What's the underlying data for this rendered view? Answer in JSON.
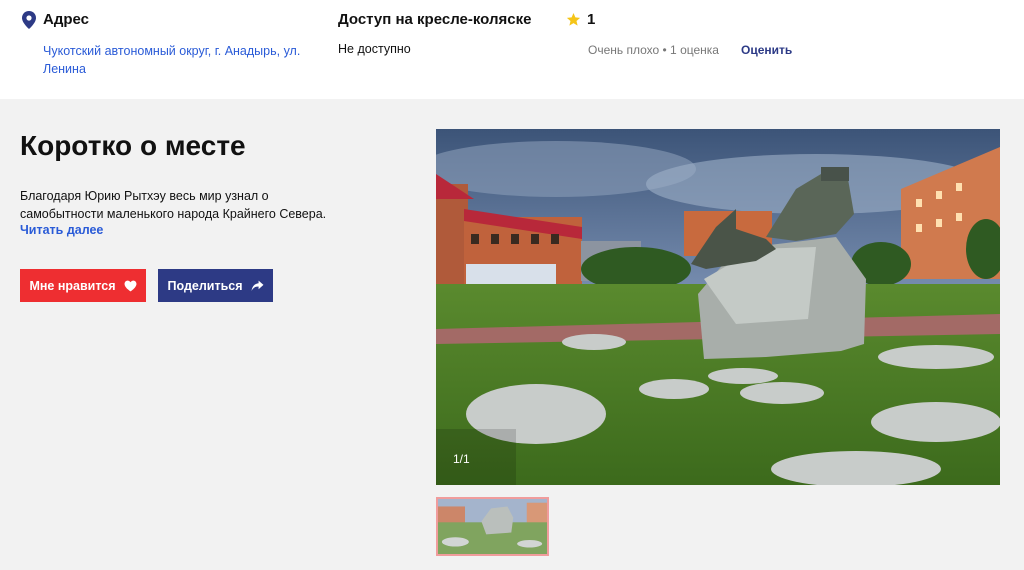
{
  "info": {
    "address": {
      "icon": "location-pin-icon",
      "title": "Адрес",
      "value": "Чукотский автономный округ, г. Анадырь, ул. Ленина"
    },
    "accessibility": {
      "title": "Доступ на кресле-коляске",
      "value": "Не доступно"
    },
    "rating": {
      "icon": "star-icon",
      "value": "1",
      "description": "Очень плохо • 1 оценка",
      "rate_label": "Оценить"
    }
  },
  "about": {
    "title": "Коротко о месте",
    "text": "Благодаря Юрию Рытхэу весь мир узнал о самобытности маленького народа Крайнего Севера.",
    "read_more": "Читать далее",
    "like_label": "Мне нравится",
    "like_icon": "heart-icon",
    "share_label": "Поделиться",
    "share_icon": "share-arrow-icon"
  },
  "gallery": {
    "counter": "1/1"
  },
  "colors": {
    "like": "#ee2e31",
    "share": "#2d3a85",
    "link": "#2a5bd7",
    "star": "#f5c518"
  }
}
